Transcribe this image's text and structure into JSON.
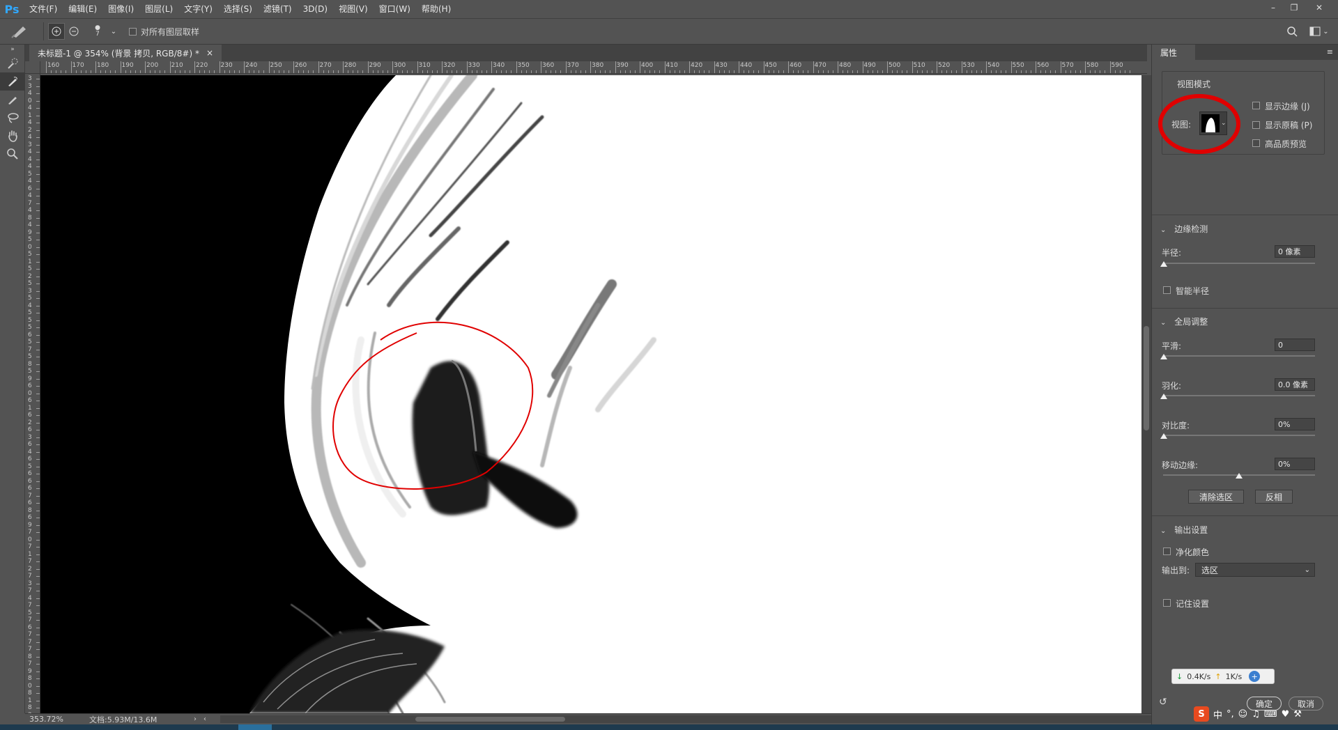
{
  "app": {
    "logo": "Ps",
    "menu": [
      "文件(F)",
      "编辑(E)",
      "图像(I)",
      "图层(L)",
      "文字(Y)",
      "选择(S)",
      "滤镜(T)",
      "3D(D)",
      "视图(V)",
      "窗口(W)",
      "帮助(H)"
    ]
  },
  "options": {
    "brush_size": "7",
    "sample_all_layers": "对所有图层取样"
  },
  "document": {
    "tab_title": "未标题-1 @ 354% (背景 拷贝, RGB/8#) *",
    "close": "×"
  },
  "ruler_top": [
    "160",
    "170",
    "180",
    "190",
    "200",
    "210",
    "220",
    "230",
    "240",
    "250",
    "260",
    "270",
    "280",
    "290",
    "300",
    "310",
    "320",
    "330",
    "340",
    "350",
    "360",
    "370",
    "380",
    "390",
    "400",
    "410",
    "420",
    "430",
    "440",
    "450",
    "460",
    "470",
    "480",
    "490",
    "500",
    "510",
    "520",
    "530",
    "540",
    "550",
    "560",
    "570",
    "580",
    "590"
  ],
  "ruler_left": [
    "3",
    "3",
    "4",
    "0",
    "4",
    "1",
    "4",
    "2",
    "4",
    "3",
    "4",
    "4",
    "4",
    "5",
    "4",
    "6",
    "4",
    "7",
    "4",
    "8",
    "4",
    "9",
    "5",
    "0",
    "5",
    "1",
    "5",
    "2",
    "5",
    "3",
    "5",
    "4",
    "5",
    "5",
    "5",
    "6",
    "5",
    "7",
    "5",
    "8",
    "5",
    "9",
    "6",
    "0",
    "6",
    "1",
    "6",
    "2",
    "6",
    "3",
    "6",
    "4",
    "6",
    "5",
    "6",
    "6",
    "6",
    "7",
    "6",
    "8",
    "6",
    "9",
    "7",
    "0",
    "7",
    "1",
    "7",
    "2",
    "7",
    "3",
    "7",
    "4",
    "7",
    "5",
    "7",
    "6",
    "7",
    "7",
    "7",
    "8",
    "7",
    "9",
    "8",
    "0",
    "8",
    "1",
    "8",
    "2",
    "8",
    "3",
    "8",
    "4"
  ],
  "status": {
    "zoom": "353.72%",
    "doc": "文档:5.93M/13.6M"
  },
  "properties": {
    "tab": "属性",
    "view_mode": {
      "title": "视图模式",
      "view_label": "视图:",
      "show_edge": "显示边缘 (J)",
      "show_original": "显示原稿 (P)",
      "hq_preview": "高品质预览"
    },
    "edge_detection": {
      "title": "边缘检测",
      "radius_label": "半径:",
      "radius_value": "0 像素",
      "smart_radius": "智能半径"
    },
    "global_refine": {
      "title": "全局调整",
      "smooth_label": "平滑:",
      "smooth_value": "0",
      "feather_label": "羽化:",
      "feather_value": "0.0 像素",
      "contrast_label": "对比度:",
      "contrast_value": "0%",
      "shift_label": "移动边缘:",
      "shift_value": "0%",
      "clear_button": "清除选区",
      "invert_button": "反相"
    },
    "output": {
      "title": "输出设置",
      "decontaminate": "净化颜色",
      "output_to_label": "输出到:",
      "output_to_value": "选区",
      "remember": "记住设置"
    },
    "ok_button": "确定",
    "cancel_button": "取消"
  },
  "network": {
    "down": "0.4K/s",
    "up": "1K/s"
  },
  "ime": {
    "mode": "中"
  }
}
